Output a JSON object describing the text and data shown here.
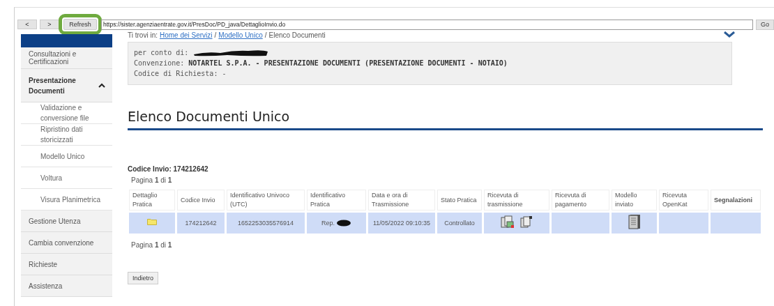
{
  "browser": {
    "back": "<",
    "forward": ">",
    "refresh": {
      "label": "Refresh",
      "highlighted": true
    },
    "url": "https://sister.agenziaentrate.gov.it/PresDoc/PD_java/DettaglioInvio.do",
    "go": "Go"
  },
  "sidebar": {
    "items": [
      {
        "kind": "banner"
      },
      {
        "kind": "group",
        "label": "Consultazioni e Certificazioni"
      },
      {
        "kind": "group",
        "label": "Presentazione Documenti",
        "expanded": true,
        "children": [
          {
            "label": "Validazione e conversione file"
          },
          {
            "label": "Ripristino dati storicizzati"
          },
          {
            "label": "Modello Unico"
          },
          {
            "label": "Voltura"
          },
          {
            "label": "Visura Planimetrica"
          }
        ]
      },
      {
        "kind": "group",
        "label": "Gestione Utenza"
      },
      {
        "kind": "group",
        "label": "Cambia convenzione"
      },
      {
        "kind": "group",
        "label": "Richieste"
      },
      {
        "kind": "group",
        "label": "Assistenza"
      }
    ]
  },
  "breadcrumb": {
    "prefix": "Ti trovi in:",
    "separator": "/",
    "links": [
      "Home dei Servizi",
      "Modello Unico"
    ],
    "current": "Elenco Documenti"
  },
  "info": {
    "per_conto_di": {
      "label": "per conto di:",
      "redacted": true
    },
    "convenzione": {
      "label": "Convenzione:",
      "value": "NOTARTEL S.P.A. - PRESENTAZIONE DOCUMENTI (PRESENTAZIONE DOCUMENTI - NOTAIO)"
    },
    "codice_richiesta": "Codice di Richiesta: -"
  },
  "heading": "Elenco Documenti Unico",
  "codice_invio": "Codice Invio: 174212642",
  "pagination_top": "Pagina **1** di **1**",
  "table": {
    "columns": [
      "Dettaglio Pratica",
      "Codice Invio",
      "Identificativo Univoco (UTC)",
      "Identificativo Pratica",
      "Data e ora di Trasmissione",
      "Stato Pratica",
      "Ricevuta di trasmissione",
      "Ricevuta di pagamento",
      "Modello inviato",
      "Ricevuta OpenKat",
      "Segnalazioni"
    ],
    "rows": [
      {
        "selected": true,
        "cells": [
          {
            "kind": "folder"
          },
          {
            "kind": "text",
            "text": "174212642"
          },
          {
            "kind": "text",
            "text": "1652253035576914"
          },
          {
            "kind": "redacted",
            "text": "Rep."
          },
          {
            "kind": "text",
            "text": "11/05/2022 09:10:35"
          },
          {
            "kind": "text",
            "text": "Controllato"
          },
          {
            "kind": "receipts"
          },
          {
            "kind": "empty"
          },
          {
            "kind": "model"
          },
          {
            "kind": "empty"
          },
          {
            "kind": "empty"
          }
        ]
      }
    ]
  },
  "pagination_bottom": "Pagina **1** di **1**",
  "back_button": "Indietro"
}
